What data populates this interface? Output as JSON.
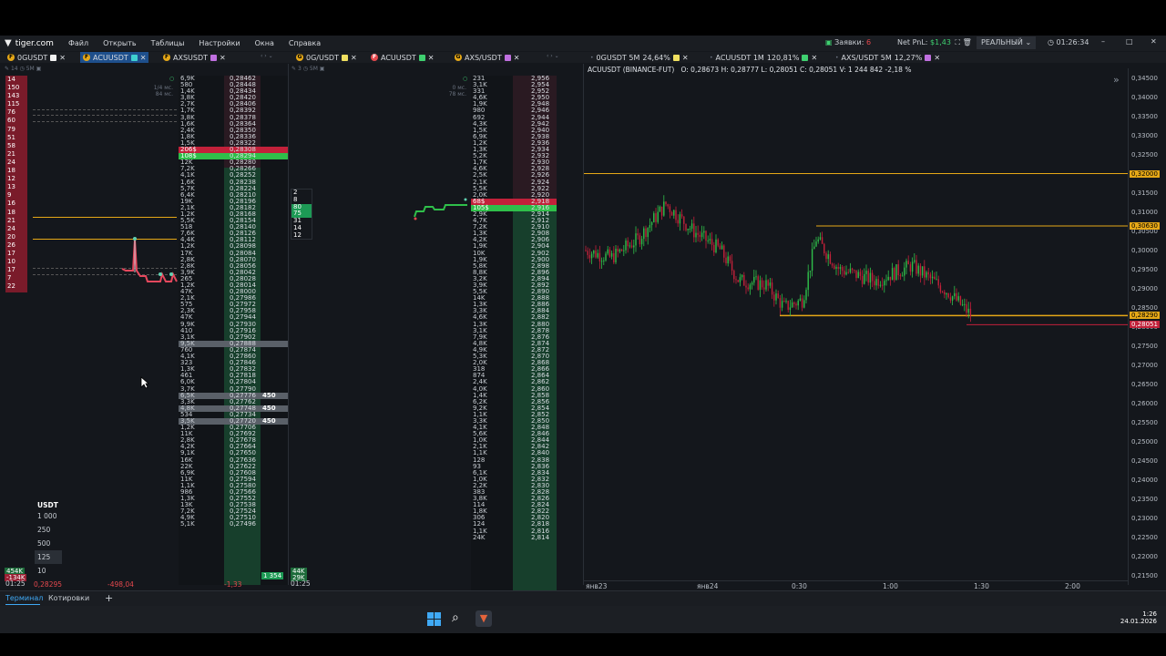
{
  "app": {
    "logo_text": "tiger.com",
    "menu": [
      "Файл",
      "Открыть",
      "Таблицы",
      "Настройки",
      "Окна",
      "Справка"
    ],
    "orders_label": "Заявки:",
    "orders_count": "6",
    "netpnl_label": "Net PnL:",
    "netpnl_value": "$1,43",
    "mode": "РЕАЛЬНЫЙ",
    "clock": "01:26:34"
  },
  "tabs": {
    "left": [
      {
        "label": "0GUSDT",
        "color": "#f2f2f2",
        "active": false
      },
      {
        "label": "ACUUSDT",
        "color": "#3fd0d0",
        "active": true
      },
      {
        "label": "AXSUSDT",
        "color": "#c070e0",
        "active": false
      }
    ],
    "mid": [
      {
        "label": "0G/USDT",
        "color": "#f0e060"
      },
      {
        "label": "ACUUSDT",
        "color": "#3fd070"
      },
      {
        "label": "AXS/USDT",
        "color": "#c070e0"
      }
    ],
    "right": [
      {
        "label": "0GUSDT 5M",
        "pct": "24,64%",
        "color": "#f0e060"
      },
      {
        "label": "ACUUSDT 1M",
        "pct": "120,81%",
        "color": "#3fd070"
      },
      {
        "label": "AXS/USDT 5M",
        "pct": "12,27%",
        "color": "#c070e0"
      }
    ]
  },
  "left_panel": {
    "scale_label": "14",
    "tf_label": "5M",
    "latency1": "1/4 мс.",
    "latency2": "84 мс.",
    "trade_counts": [
      "14",
      "150",
      "143",
      "115",
      "76",
      "60",
      "79",
      "51",
      "58",
      "21",
      "24",
      "18",
      "12",
      "13",
      "9",
      "16",
      "18",
      "21",
      "24",
      "20",
      "26",
      "17",
      "10",
      "17",
      "7",
      "22"
    ],
    "usdt_header": "USDT",
    "usdt_options": [
      "1 000",
      "250",
      "500",
      "125",
      "10"
    ],
    "footer_vol1": "454K",
    "footer_vol2": "-134K",
    "footer_price": "0,28295",
    "footer_pnl": "-498,04",
    "time": "01:25"
  },
  "orderbook1": {
    "rows": [
      [
        "6,9K",
        "0,28462"
      ],
      [
        "580",
        "0,28448"
      ],
      [
        "1,4K",
        "0,28434"
      ],
      [
        "3,8K",
        "0,28420"
      ],
      [
        "2,7K",
        "0,28406"
      ],
      [
        "1,7K",
        "0,28392"
      ],
      [
        "3,8K",
        "0,28378"
      ],
      [
        "1,6K",
        "0,28364"
      ],
      [
        "2,4K",
        "0,28350"
      ],
      [
        "1,8K",
        "0,28336"
      ],
      [
        "1,5K",
        "0,28322"
      ],
      [
        "206$",
        "0,28308"
      ],
      [
        "108$",
        "0,28294"
      ],
      [
        "12K",
        "0,28280"
      ],
      [
        "7,2K",
        "0,28266"
      ],
      [
        "4,1K",
        "0,28252"
      ],
      [
        "1,6K",
        "0,28238"
      ],
      [
        "5,7K",
        "0,28224"
      ],
      [
        "6,4K",
        "0,28210"
      ],
      [
        "19K",
        "0,28196"
      ],
      [
        "2,1K",
        "0,28182"
      ],
      [
        "1,2K",
        "0,28168"
      ],
      [
        "5,5K",
        "0,28154"
      ],
      [
        "518",
        "0,28140"
      ],
      [
        "7,6K",
        "0,28126"
      ],
      [
        "4,4K",
        "0,28112"
      ],
      [
        "1,2K",
        "0,28098"
      ],
      [
        "17K",
        "0,28084"
      ],
      [
        "2,8K",
        "0,28070"
      ],
      [
        "2,8K",
        "0,28056"
      ],
      [
        "3,9K",
        "0,28042"
      ],
      [
        "265",
        "0,28028"
      ],
      [
        "1,2K",
        "0,28014"
      ],
      [
        "47K",
        "0,28000"
      ],
      [
        "2,1K",
        "0,27986"
      ],
      [
        "575",
        "0,27972"
      ],
      [
        "2,3K",
        "0,27958"
      ],
      [
        "47K",
        "0,27944"
      ],
      [
        "9,9K",
        "0,27930"
      ],
      [
        "410",
        "0,27916"
      ],
      [
        "3,1K",
        "0,27902"
      ],
      [
        "9,5K",
        "0,27888"
      ],
      [
        "760",
        "0,27874"
      ],
      [
        "4,1K",
        "0,27860"
      ],
      [
        "323",
        "0,27846"
      ],
      [
        "1,3K",
        "0,27832"
      ],
      [
        "461",
        "0,27818"
      ],
      [
        "6,0K",
        "0,27804"
      ],
      [
        "3,7K",
        "0,27790"
      ],
      [
        "6,5K",
        "0,27776"
      ],
      [
        "3,3K",
        "0,27762"
      ],
      [
        "4,8K",
        "0,27748"
      ],
      [
        "534",
        "0,27734"
      ],
      [
        "3,5K",
        "0,27720"
      ],
      [
        "1,2K",
        "0,27706"
      ],
      [
        "11K",
        "0,27692"
      ],
      [
        "2,8K",
        "0,27678"
      ],
      [
        "4,2K",
        "0,27664"
      ],
      [
        "9,1K",
        "0,27650"
      ],
      [
        "16K",
        "0,27636"
      ],
      [
        "22K",
        "0,27622"
      ],
      [
        "6,9K",
        "0,27608"
      ],
      [
        "11K",
        "0,27594"
      ],
      [
        "1,1K",
        "0,27580"
      ],
      [
        "986",
        "0,27566"
      ],
      [
        "1,3K",
        "0,27552"
      ],
      [
        "13K",
        "0,27538"
      ],
      [
        "7,2K",
        "0,27524"
      ],
      [
        "4,9K",
        "0,27510"
      ],
      [
        "5,1K",
        "0,27496"
      ]
    ],
    "order_size": "450",
    "footer_pnl": "-1,33",
    "bottom_badge": "1 354"
  },
  "mid_panel": {
    "scale_label": "3",
    "tf_label": "5M",
    "latency1": "0 мс.",
    "latency2": "78 мс.",
    "trade_counts": [
      "2",
      "8",
      "80",
      "75",
      "31",
      "14",
      "12"
    ],
    "footer_vol1": "44K",
    "footer_vol2": "29K",
    "time": "01:25"
  },
  "orderbook2": {
    "rows": [
      [
        "231",
        "2,956"
      ],
      [
        "3,1K",
        "2,954"
      ],
      [
        "331",
        "2,952"
      ],
      [
        "4,6K",
        "2,950"
      ],
      [
        "1,9K",
        "2,948"
      ],
      [
        "980",
        "2,946"
      ],
      [
        "692",
        "2,944"
      ],
      [
        "4,3K",
        "2,942"
      ],
      [
        "1,5K",
        "2,940"
      ],
      [
        "6,9K",
        "2,938"
      ],
      [
        "1,2K",
        "2,936"
      ],
      [
        "1,3K",
        "2,934"
      ],
      [
        "5,2K",
        "2,932"
      ],
      [
        "1,7K",
        "2,930"
      ],
      [
        "4,6K",
        "2,928"
      ],
      [
        "2,5K",
        "2,926"
      ],
      [
        "2,1K",
        "2,924"
      ],
      [
        "5,5K",
        "2,922"
      ],
      [
        "2,0K",
        "2,920"
      ],
      [
        "68$",
        "2,918"
      ],
      [
        "105$",
        "2,916"
      ],
      [
        "2,9K",
        "2,914"
      ],
      [
        "4,7K",
        "2,912"
      ],
      [
        "7,2K",
        "2,910"
      ],
      [
        "1,3K",
        "2,908"
      ],
      [
        "4,2K",
        "2,906"
      ],
      [
        "1,9K",
        "2,904"
      ],
      [
        "10K",
        "2,902"
      ],
      [
        "1,9K",
        "2,900"
      ],
      [
        "5,8K",
        "2,898"
      ],
      [
        "8,8K",
        "2,896"
      ],
      [
        "3,2K",
        "2,894"
      ],
      [
        "3,9K",
        "2,892"
      ],
      [
        "5,5K",
        "2,890"
      ],
      [
        "14K",
        "2,888"
      ],
      [
        "1,3K",
        "2,886"
      ],
      [
        "3,3K",
        "2,884"
      ],
      [
        "4,6K",
        "2,882"
      ],
      [
        "1,3K",
        "2,880"
      ],
      [
        "3,1K",
        "2,878"
      ],
      [
        "7,9K",
        "2,876"
      ],
      [
        "4,8K",
        "2,874"
      ],
      [
        "4,9K",
        "2,872"
      ],
      [
        "5,3K",
        "2,870"
      ],
      [
        "2,0K",
        "2,868"
      ],
      [
        "318",
        "2,866"
      ],
      [
        "874",
        "2,864"
      ],
      [
        "2,4K",
        "2,862"
      ],
      [
        "4,0K",
        "2,860"
      ],
      [
        "1,4K",
        "2,858"
      ],
      [
        "6,2K",
        "2,856"
      ],
      [
        "9,2K",
        "2,854"
      ],
      [
        "1,1K",
        "2,852"
      ],
      [
        "3,3K",
        "2,850"
      ],
      [
        "4,1K",
        "2,848"
      ],
      [
        "5,6K",
        "2,846"
      ],
      [
        "1,0K",
        "2,844"
      ],
      [
        "2,1K",
        "2,842"
      ],
      [
        "1,1K",
        "2,840"
      ],
      [
        "128",
        "2,838"
      ],
      [
        "93",
        "2,836"
      ],
      [
        "6,1K",
        "2,834"
      ],
      [
        "1,0K",
        "2,832"
      ],
      [
        "2,2K",
        "2,830"
      ],
      [
        "383",
        "2,828"
      ],
      [
        "3,8K",
        "2,826"
      ],
      [
        "114",
        "2,824"
      ],
      [
        "1,8K",
        "2,822"
      ],
      [
        "306",
        "2,820"
      ],
      [
        "124",
        "2,818"
      ],
      [
        "1,1K",
        "2,816"
      ],
      [
        "24K",
        "2,814"
      ]
    ]
  },
  "chart": {
    "symbol_line": "ACUUSDT (BINANCE-FUT)",
    "ohlc": "O: 0,28673  H: 0,28777  L: 0,28051  C: 0,28051  V: 1 244 842  -2,18 %",
    "y_ticks": [
      "0,34500",
      "0,34000",
      "0,33500",
      "0,33000",
      "0,32500",
      "0,32000",
      "0,31500",
      "0,31000",
      "0,30500",
      "0,30000",
      "0,29500",
      "0,29000",
      "0,28500",
      "0,28000",
      "0,27500",
      "0,27000",
      "0,26500",
      "0,26000",
      "0,25500",
      "0,25000",
      "0,24500",
      "0,24000",
      "0,23500",
      "0,23000",
      "0,22500",
      "0,22000",
      "0,21500"
    ],
    "level_high": "0,32000",
    "level_mid": "0,30630",
    "level_low": "0,28290",
    "last_price": "0,28051",
    "x_labels": [
      "янв23",
      "янв24",
      "0:30",
      "1:00",
      "1:30",
      "2:00"
    ],
    "colors": {
      "up": "#2fbf4a",
      "down": "#c2213a",
      "level": "#e6a817"
    }
  },
  "bottom_tabs": [
    "Терминал",
    "Котировки",
    "+"
  ],
  "taskbar": {
    "time": "1:26",
    "date": "24.01.2026"
  }
}
